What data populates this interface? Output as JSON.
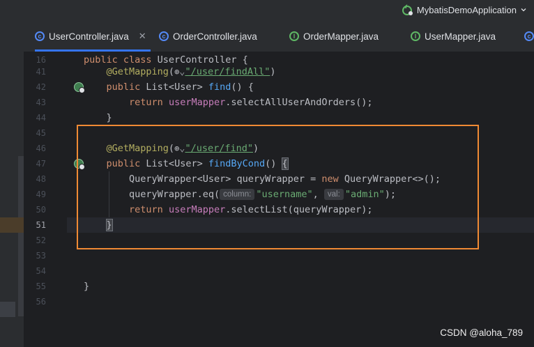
{
  "run_config": {
    "label": "MybatisDemoApplication",
    "chevron": "chevron-down-icon"
  },
  "tabs": [
    {
      "label": "UserController.java",
      "icon": "class-icon",
      "active": true
    },
    {
      "label": "OrderController.java",
      "icon": "class-icon",
      "active": false
    },
    {
      "label": "OrderMapper.java",
      "icon": "interface-icon",
      "active": false
    },
    {
      "label": "UserMapper.java",
      "icon": "interface-icon",
      "active": false
    }
  ],
  "sticky_header": {
    "line": "16",
    "code": "public class UserController {"
  },
  "lines": [
    {
      "no": "41"
    },
    {
      "no": "42"
    },
    {
      "no": "43"
    },
    {
      "no": "44"
    },
    {
      "no": "45"
    },
    {
      "no": "46"
    },
    {
      "no": "47"
    },
    {
      "no": "48"
    },
    {
      "no": "49"
    },
    {
      "no": "50"
    },
    {
      "no": "51"
    },
    {
      "no": "52"
    },
    {
      "no": "53"
    },
    {
      "no": "54"
    },
    {
      "no": "55"
    },
    {
      "no": "56"
    }
  ],
  "code": {
    "ann1": "@GetMapping",
    "path1": "\"/user/findAll\"",
    "public": "public",
    "list_user": " List<User> ",
    "find": "find",
    "find_rest": "() {",
    "return": "return",
    "userMapper": "userMapper",
    "selectAll": ".selectAllUserAndOrders();",
    "close_brace": "}",
    "ann2": "@GetMapping",
    "path2": "\"/user/find\"",
    "paren_open": "(",
    "paren_close": ")",
    "findByCond": "findByCond",
    "fbc_rest": "() ",
    "open_brace": "{",
    "qw_decl": "QueryWrapper<User> queryWrapper = ",
    "new": "new",
    "qw_ctor": " QueryWrapper<>();",
    "qw_eq": "queryWrapper.eq(",
    "hint_column": "column:",
    "str_username": "\"username\"",
    "comma": ", ",
    "hint_val": "val:",
    "str_admin": "\"admin\"",
    "eq_end": ");",
    "selectList": ".selectList(queryWrapper);",
    "class_close": "}"
  },
  "colors": {
    "highlight_box": "#f08a34",
    "accent": "#3574f0",
    "keyword": "#cf8e6d",
    "string": "#6aab73",
    "method": "#56a8f5",
    "field": "#c77dbb"
  },
  "watermark": "CSDN @aloha_789"
}
